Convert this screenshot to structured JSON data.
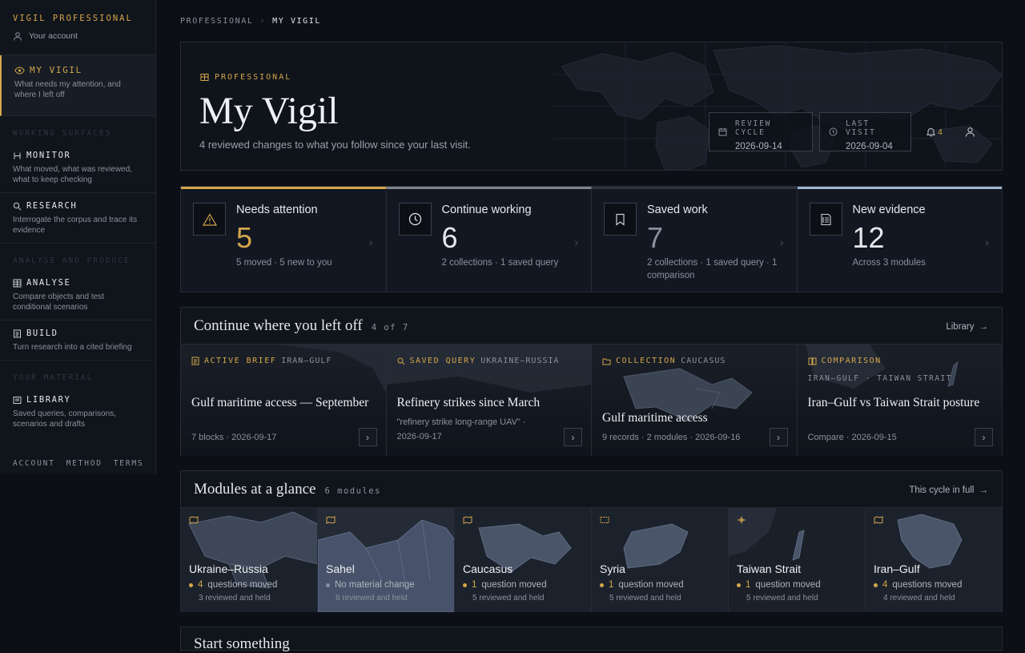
{
  "sidebar": {
    "brand": "VIGIL PROFESSIONAL",
    "account": "Your account",
    "active": {
      "label": "MY VIGIL",
      "desc": "What needs my attention, and where I left off"
    },
    "sections": [
      {
        "label": "WORKING SURFACES",
        "items": [
          {
            "label": "MONITOR",
            "desc": "What moved, what was reviewed, what to keep checking"
          },
          {
            "label": "RESEARCH",
            "desc": "Interrogate the corpus and trace its evidence"
          }
        ]
      },
      {
        "label": "ANALYSE AND PRODUCE",
        "items": [
          {
            "label": "ANALYSE",
            "desc": "Compare objects and test conditional scenarios"
          },
          {
            "label": "BUILD",
            "desc": "Turn research into a cited briefing"
          }
        ]
      },
      {
        "label": "YOUR MATERIAL",
        "items": [
          {
            "label": "LIBRARY",
            "desc": "Saved queries, comparisons, scenarios and drafts"
          }
        ]
      }
    ],
    "footer": [
      "ACCOUNT",
      "METHOD",
      "TERMS"
    ]
  },
  "breadcrumb": {
    "root": "PROFESSIONAL",
    "sep": "›",
    "current": "MY VIGIL"
  },
  "hero": {
    "tag": "PROFESSIONAL",
    "title": "My Vigil",
    "subtitle": "4 reviewed changes to what you follow since your last visit.",
    "review_label": "REVIEW CYCLE",
    "review_value": "2026-09-14",
    "visit_label": "LAST VISIT",
    "visit_value": "2026-09-04",
    "notifications": "4"
  },
  "stats": [
    {
      "label": "Needs attention",
      "value": "5",
      "sub": "5 moved · 5 new to you",
      "accent": "#d4a64a"
    },
    {
      "label": "Continue working",
      "value": "6",
      "sub": "2 collections · 1 saved query",
      "accent": "#8b919c"
    },
    {
      "label": "Saved work",
      "value": "7",
      "sub": "2 collections · 1 saved query · 1 comparison",
      "accent": "#2e333c"
    },
    {
      "label": "New evidence",
      "value": "12",
      "sub": "Across 3 modules",
      "accent": "#9fb5cc"
    }
  ],
  "continue": {
    "title": "Continue where you left off",
    "count": "4 of 7",
    "link": "Library",
    "cards": [
      {
        "kind": "ACTIVE BRIEF",
        "region": "IRAN–GULF",
        "title": "Gulf maritime access — September",
        "meta": "7 blocks · 2026-09-17"
      },
      {
        "kind": "SAVED QUERY",
        "region": "UKRAINE–RUSSIA",
        "title": "Refinery strikes since March",
        "meta": "\"refinery strike long-range UAV\" · 2026-09-17"
      },
      {
        "kind": "COLLECTION",
        "region": "CAUCASUS",
        "title": "Gulf maritime access",
        "meta": "9 records · 2 modules · 2026-09-16"
      },
      {
        "kind": "COMPARISON",
        "region": "IRAN–GULF · TAIWAN STRAIT",
        "title": "Iran–Gulf vs Taiwan Strait posture",
        "meta": "Compare · 2026-09-15"
      }
    ]
  },
  "modules": {
    "title": "Modules at a glance",
    "count": "6 modules",
    "link": "This cycle in full",
    "items": [
      {
        "name": "Ukraine–Russia",
        "num": "4",
        "q": "questions moved",
        "r": "3 reviewed and held"
      },
      {
        "name": "Sahel",
        "num": "",
        "q": "No material change",
        "r": "8 reviewed and held"
      },
      {
        "name": "Caucasus",
        "num": "1",
        "q": "question moved",
        "r": "5 reviewed and held"
      },
      {
        "name": "Syria",
        "num": "1",
        "q": "question moved",
        "r": "5 reviewed and held"
      },
      {
        "name": "Taiwan Strait",
        "num": "1",
        "q": "question moved",
        "r": "5 reviewed and held"
      },
      {
        "name": "Iran–Gulf",
        "num": "4",
        "q": "questions moved",
        "r": "4 reviewed and held"
      }
    ]
  },
  "start": {
    "title": "Start something"
  }
}
